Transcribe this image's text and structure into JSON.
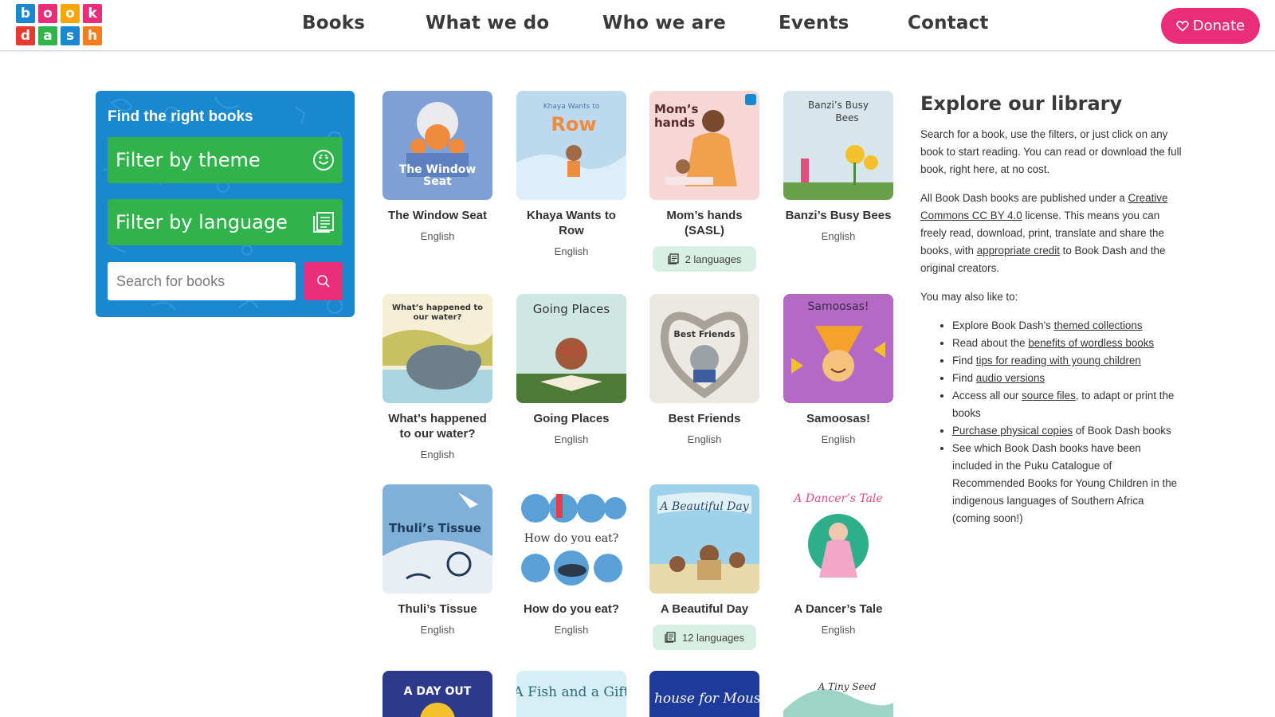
{
  "logo": {
    "letters": [
      {
        "ch": "b",
        "color": "#1a88d0"
      },
      {
        "ch": "o",
        "color": "#e92d78"
      },
      {
        "ch": "o",
        "color": "#f6a800"
      },
      {
        "ch": "k",
        "color": "#e92d78"
      },
      {
        "ch": "d",
        "color": "#e8392e"
      },
      {
        "ch": "a",
        "color": "#2fb34a"
      },
      {
        "ch": "s",
        "color": "#1a88d0"
      },
      {
        "ch": "h",
        "color": "#f57c1f"
      }
    ]
  },
  "nav": {
    "books": "Books",
    "what_we_do": "What we do",
    "who_we_are": "Who we are",
    "events": "Events",
    "contact": "Contact",
    "donate": "Donate"
  },
  "filters": {
    "title": "Find the right books",
    "theme": "Filter by theme",
    "language": "Filter by language",
    "search_placeholder": "Search for books"
  },
  "books": [
    {
      "title": "The Window Seat",
      "lang": "English",
      "pill": false,
      "cover": "window"
    },
    {
      "title": "Khaya Wants to Row",
      "lang": "English",
      "pill": false,
      "cover": "khaya"
    },
    {
      "title": "Mom’s hands (SASL)",
      "lang": "2 languages",
      "pill": true,
      "cover": "mom"
    },
    {
      "title": "Banzi’s Busy Bees",
      "lang": "English",
      "pill": false,
      "cover": "banzi"
    },
    {
      "title": "What’s happened to our water?",
      "lang": "English",
      "pill": false,
      "cover": "water"
    },
    {
      "title": "Going Places",
      "lang": "English",
      "pill": false,
      "cover": "going"
    },
    {
      "title": "Best Friends",
      "lang": "English",
      "pill": false,
      "cover": "friends"
    },
    {
      "title": "Samoosas!",
      "lang": "English",
      "pill": false,
      "cover": "samoosas"
    },
    {
      "title": "Thuli’s Tissue",
      "lang": "English",
      "pill": false,
      "cover": "thuli"
    },
    {
      "title": "How do you eat?",
      "lang": "English",
      "pill": false,
      "cover": "eat"
    },
    {
      "title": "A Beautiful Day",
      "lang": "12 languages",
      "pill": true,
      "cover": "beautiful"
    },
    {
      "title": "A Dancer’s Tale",
      "lang": "English",
      "pill": false,
      "cover": "dancer"
    }
  ],
  "partial_books": [
    {
      "cover": "dayout",
      "text": "A DAY OUT"
    },
    {
      "cover": "fish",
      "text": "A Fish and a Gift"
    },
    {
      "cover": "house",
      "text": "A house for Mouse"
    },
    {
      "cover": "seed",
      "text": "A Tiny Seed"
    }
  ],
  "cover_text": {
    "window": "The Window Seat",
    "khaya_a": "Khaya Wants to",
    "khaya_b": "Row",
    "mom": "Mom’s hands",
    "banzi": "Banzi’s Busy Bees",
    "water": "What’s happened to our water?",
    "going": "Going Places",
    "friends": "Best Friends",
    "samoosas": "Samoosas!",
    "thuli": "Thuli’s Tissue",
    "eat": "How do you eat?",
    "beautiful": "A Beautiful Day",
    "dancer": "A Dancer’s Tale"
  },
  "explore": {
    "heading": "Explore our library",
    "p1": "Search for a book, use the filters, or just click on any book to start reading. You can read or download the full book, right here, at no cost.",
    "p2_a": "All Book Dash books are published under a ",
    "p2_link1": "Creative Commons CC BY 4.0",
    "p2_b": " license. This means you can freely read, download, print, translate and share the books, with ",
    "p2_link2": "appropriate credit",
    "p2_c": " to Book Dash and the original creators.",
    "p3": "You may also like to:",
    "li1_a": "Explore Book Dash's ",
    "li1_link": "themed collections",
    "li2_a": "Read about the ",
    "li2_link": "benefits of wordless books",
    "li3_a": "Find ",
    "li3_link": "tips for reading with young children",
    "li4_a": "Find ",
    "li4_link": "audio versions",
    "li5_a": "Access all our ",
    "li5_link": "source files",
    "li5_b": ", to adapt or print the books",
    "li6_link": "Purchase physical copies",
    "li6_b": " of Book Dash books",
    "li7": "See which Book Dash books have been included in the Puku Catalogue of Recommended Books for Young Children in the indigenous languages of Southern Africa (coming soon!)"
  }
}
